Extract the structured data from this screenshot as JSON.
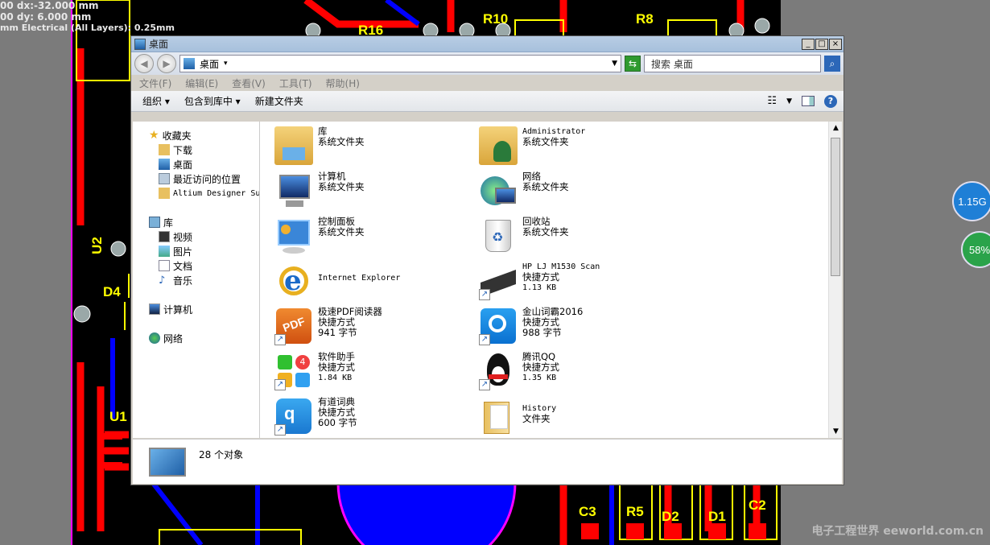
{
  "pcb": {
    "coords": [
      "00   dx:-32.000 mm",
      "00   dy:  6.000 mm",
      "mm Electrical (All Layers): 0.25mm"
    ],
    "labels": [
      "R10",
      "R8",
      "R16",
      "U2",
      "D4",
      "U1",
      "C3",
      "R5",
      "D2",
      "D1",
      "C2"
    ],
    "widgets": [
      "1.15G",
      "58%"
    ]
  },
  "window": {
    "title": "桌面",
    "controls": [
      "_",
      "□",
      "×"
    ],
    "address": "桌面",
    "search_placeholder": "搜索 桌面",
    "menu": [
      "文件(F)",
      "编辑(E)",
      "查看(V)",
      "工具(T)",
      "帮助(H)"
    ],
    "commands": [
      "组织 ▾",
      "包含到库中 ▾",
      "新建文件夹"
    ]
  },
  "sidebar": {
    "favorites": "收藏夹",
    "favorite_items": [
      "下载",
      "桌面",
      "最近访问的位置",
      "Altium Designer Su"
    ],
    "libraries": "库",
    "library_items": [
      "视频",
      "图片",
      "文档",
      "音乐"
    ],
    "computer": "计算机",
    "network": "网络"
  },
  "files": [
    {
      "name": "库",
      "sub": "系统文件夹",
      "size": "",
      "icon": "library-folder-icon"
    },
    {
      "name": "Administrator",
      "sub": "系统文件夹",
      "size": "",
      "icon": "user-folder-icon"
    },
    {
      "name": "计算机",
      "sub": "系统文件夹",
      "size": "",
      "icon": "computer-icon"
    },
    {
      "name": "网络",
      "sub": "系统文件夹",
      "size": "",
      "icon": "network-icon"
    },
    {
      "name": "控制面板",
      "sub": "系统文件夹",
      "size": "",
      "icon": "control-panel-icon"
    },
    {
      "name": "回收站",
      "sub": "系统文件夹",
      "size": "",
      "icon": "recycle-bin-icon"
    },
    {
      "name": "Internet Explorer",
      "sub": "",
      "size": "",
      "icon": "ie-icon"
    },
    {
      "name": "HP LJ M1530 Scan",
      "sub": "快捷方式",
      "size": "1.13 KB",
      "icon": "scanner-icon"
    },
    {
      "name": "极速PDF阅读器",
      "sub": "快捷方式",
      "size": "941 字节",
      "icon": "pdf-reader-icon"
    },
    {
      "name": "金山词霸2016",
      "sub": "快捷方式",
      "size": "988 字节",
      "icon": "dictionary-icon"
    },
    {
      "name": "软件助手",
      "sub": "快捷方式",
      "size": "1.84 KB",
      "icon": "software-helper-icon"
    },
    {
      "name": "腾讯QQ",
      "sub": "快捷方式",
      "size": "1.35 KB",
      "icon": "qq-icon"
    },
    {
      "name": "有道词典",
      "sub": "快捷方式",
      "size": "600 字节",
      "icon": "youdao-icon"
    },
    {
      "name": "History",
      "sub": "文件夹",
      "size": "",
      "icon": "folder-icon"
    }
  ],
  "status": {
    "count": "28 个对象"
  },
  "watermark": "电子工程世界 eeworld.com.cn"
}
